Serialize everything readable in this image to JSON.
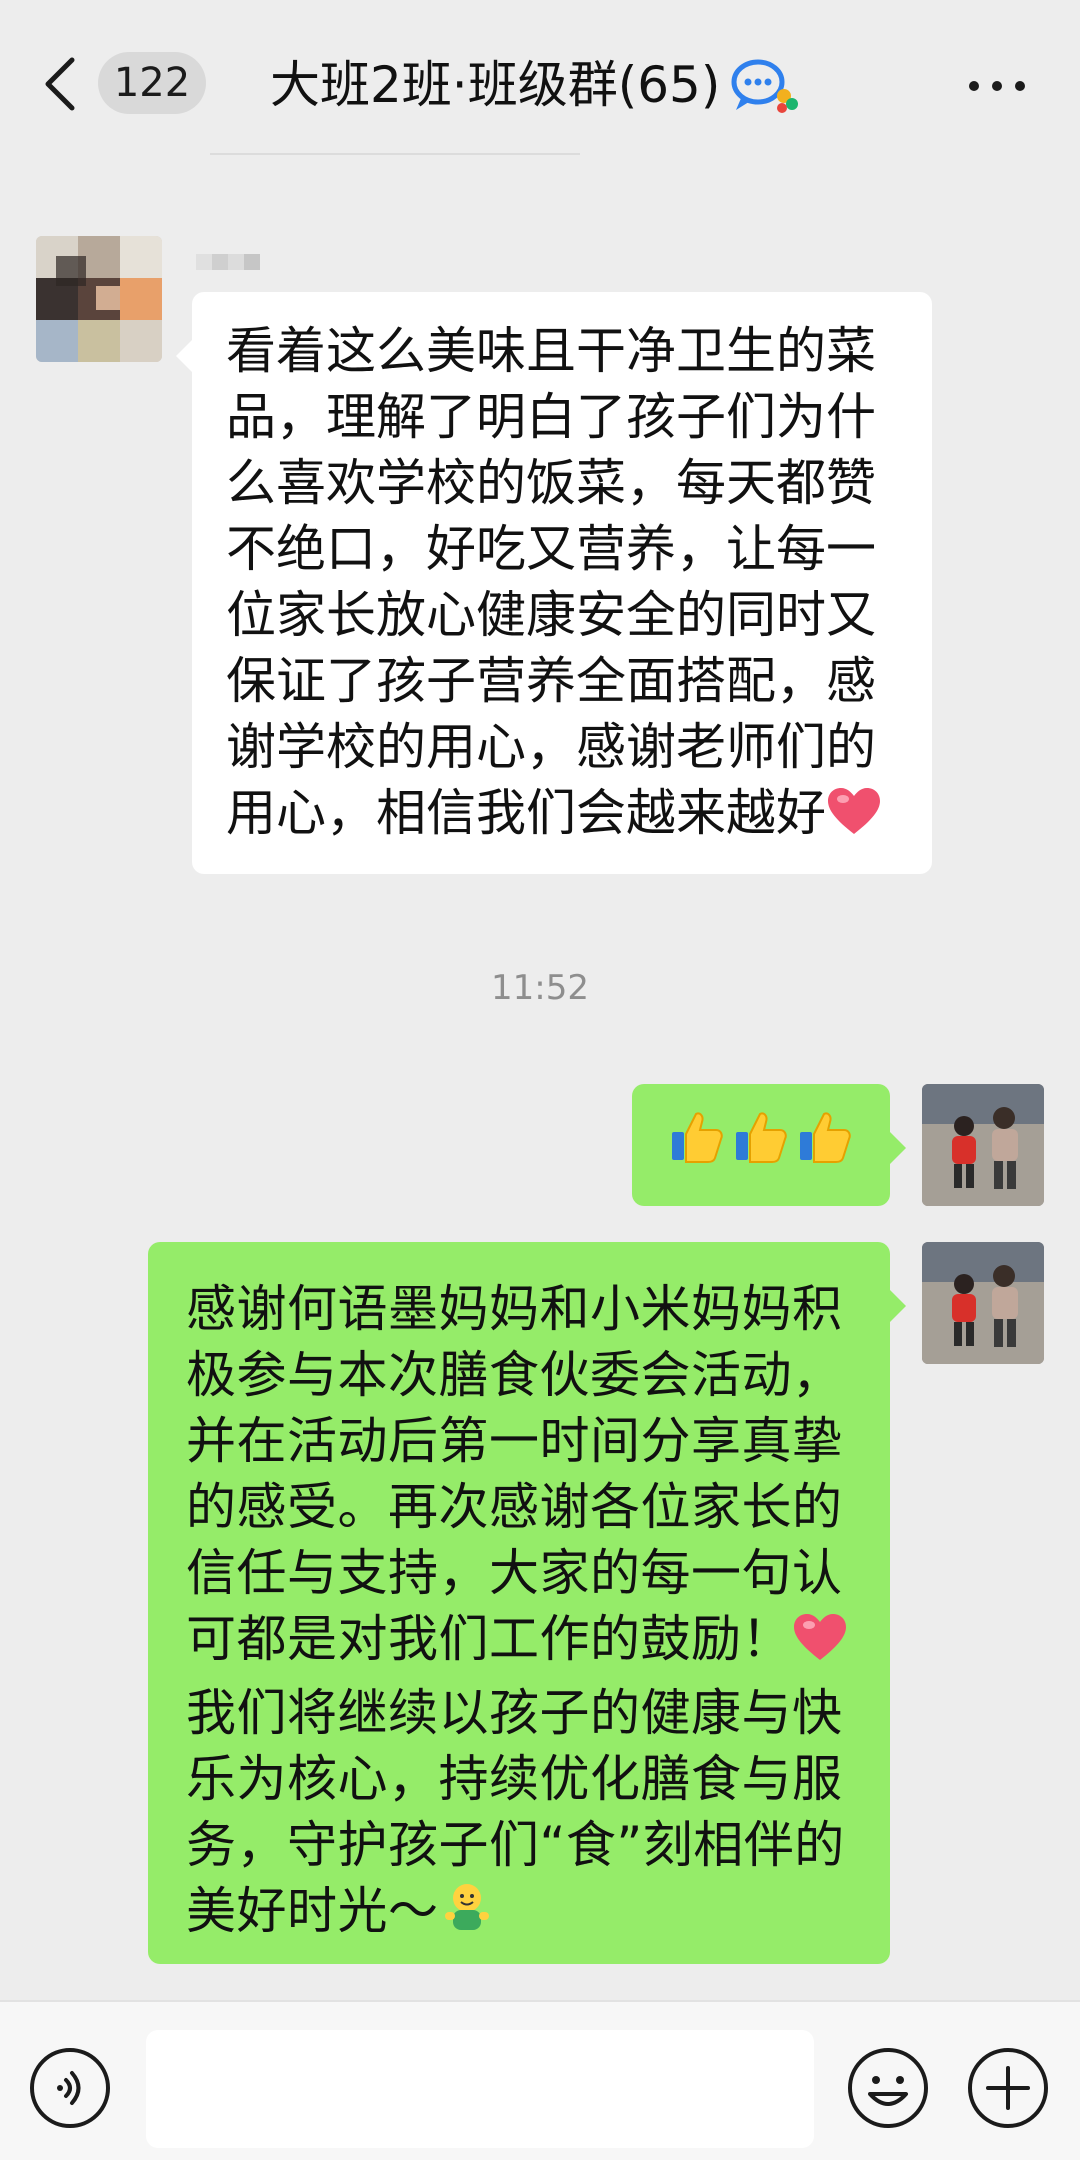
{
  "header": {
    "back_icon": "chevron-left-icon",
    "unread_count": "122",
    "title": "大班2班·班级群(65)",
    "group_icon": "group-chat-icon",
    "more_icon": "more-dots-icon"
  },
  "messages": [
    {
      "direction": "incoming",
      "avatar": "blurred-avatar",
      "text": "看着这么美味且干净卫生的菜品，理解了明白了孩子们为什么喜欢学校的饭菜，每天都赞不绝口，好吃又营养，让每一位家长放心健康安全的同时又保证了孩子营养全面搭配，感谢学校的用心，感谢老师们的用心，相信我们会越来越好",
      "trailing_emoji": "heart-emoji"
    },
    {
      "type": "timestamp",
      "text": "11:52"
    },
    {
      "direction": "outgoing",
      "avatar": "children-photo-avatar",
      "emojis": [
        "thumbs-up-emoji",
        "thumbs-up-emoji",
        "thumbs-up-emoji"
      ]
    },
    {
      "direction": "outgoing",
      "avatar": "children-photo-avatar",
      "text_part1": "感谢何语墨妈妈和小米妈妈积极参与本次膳食伙委会活动，并在活动后第一时间分享真挚的感受。再次感谢各位家长的信任与支持，大家的每一句认可都是对我们工作的鼓励！",
      "mid_emoji": "heart-emoji",
      "text_part2": "我们将继续以孩子的健康与快乐为核心，持续优化膳食与服务，守护孩子们“食”刻相伴的美好时光～",
      "trailing_emoji": "smiling-figure-emoji"
    }
  ],
  "input_bar": {
    "voice_icon": "voice-icon",
    "input_value": "",
    "emoji_icon": "emoji-icon",
    "add_icon": "plus-icon"
  },
  "colors": {
    "background": "#ededed",
    "incoming_bubble": "#ffffff",
    "outgoing_bubble": "#95ec69",
    "timestamp": "#8e8e8e"
  }
}
